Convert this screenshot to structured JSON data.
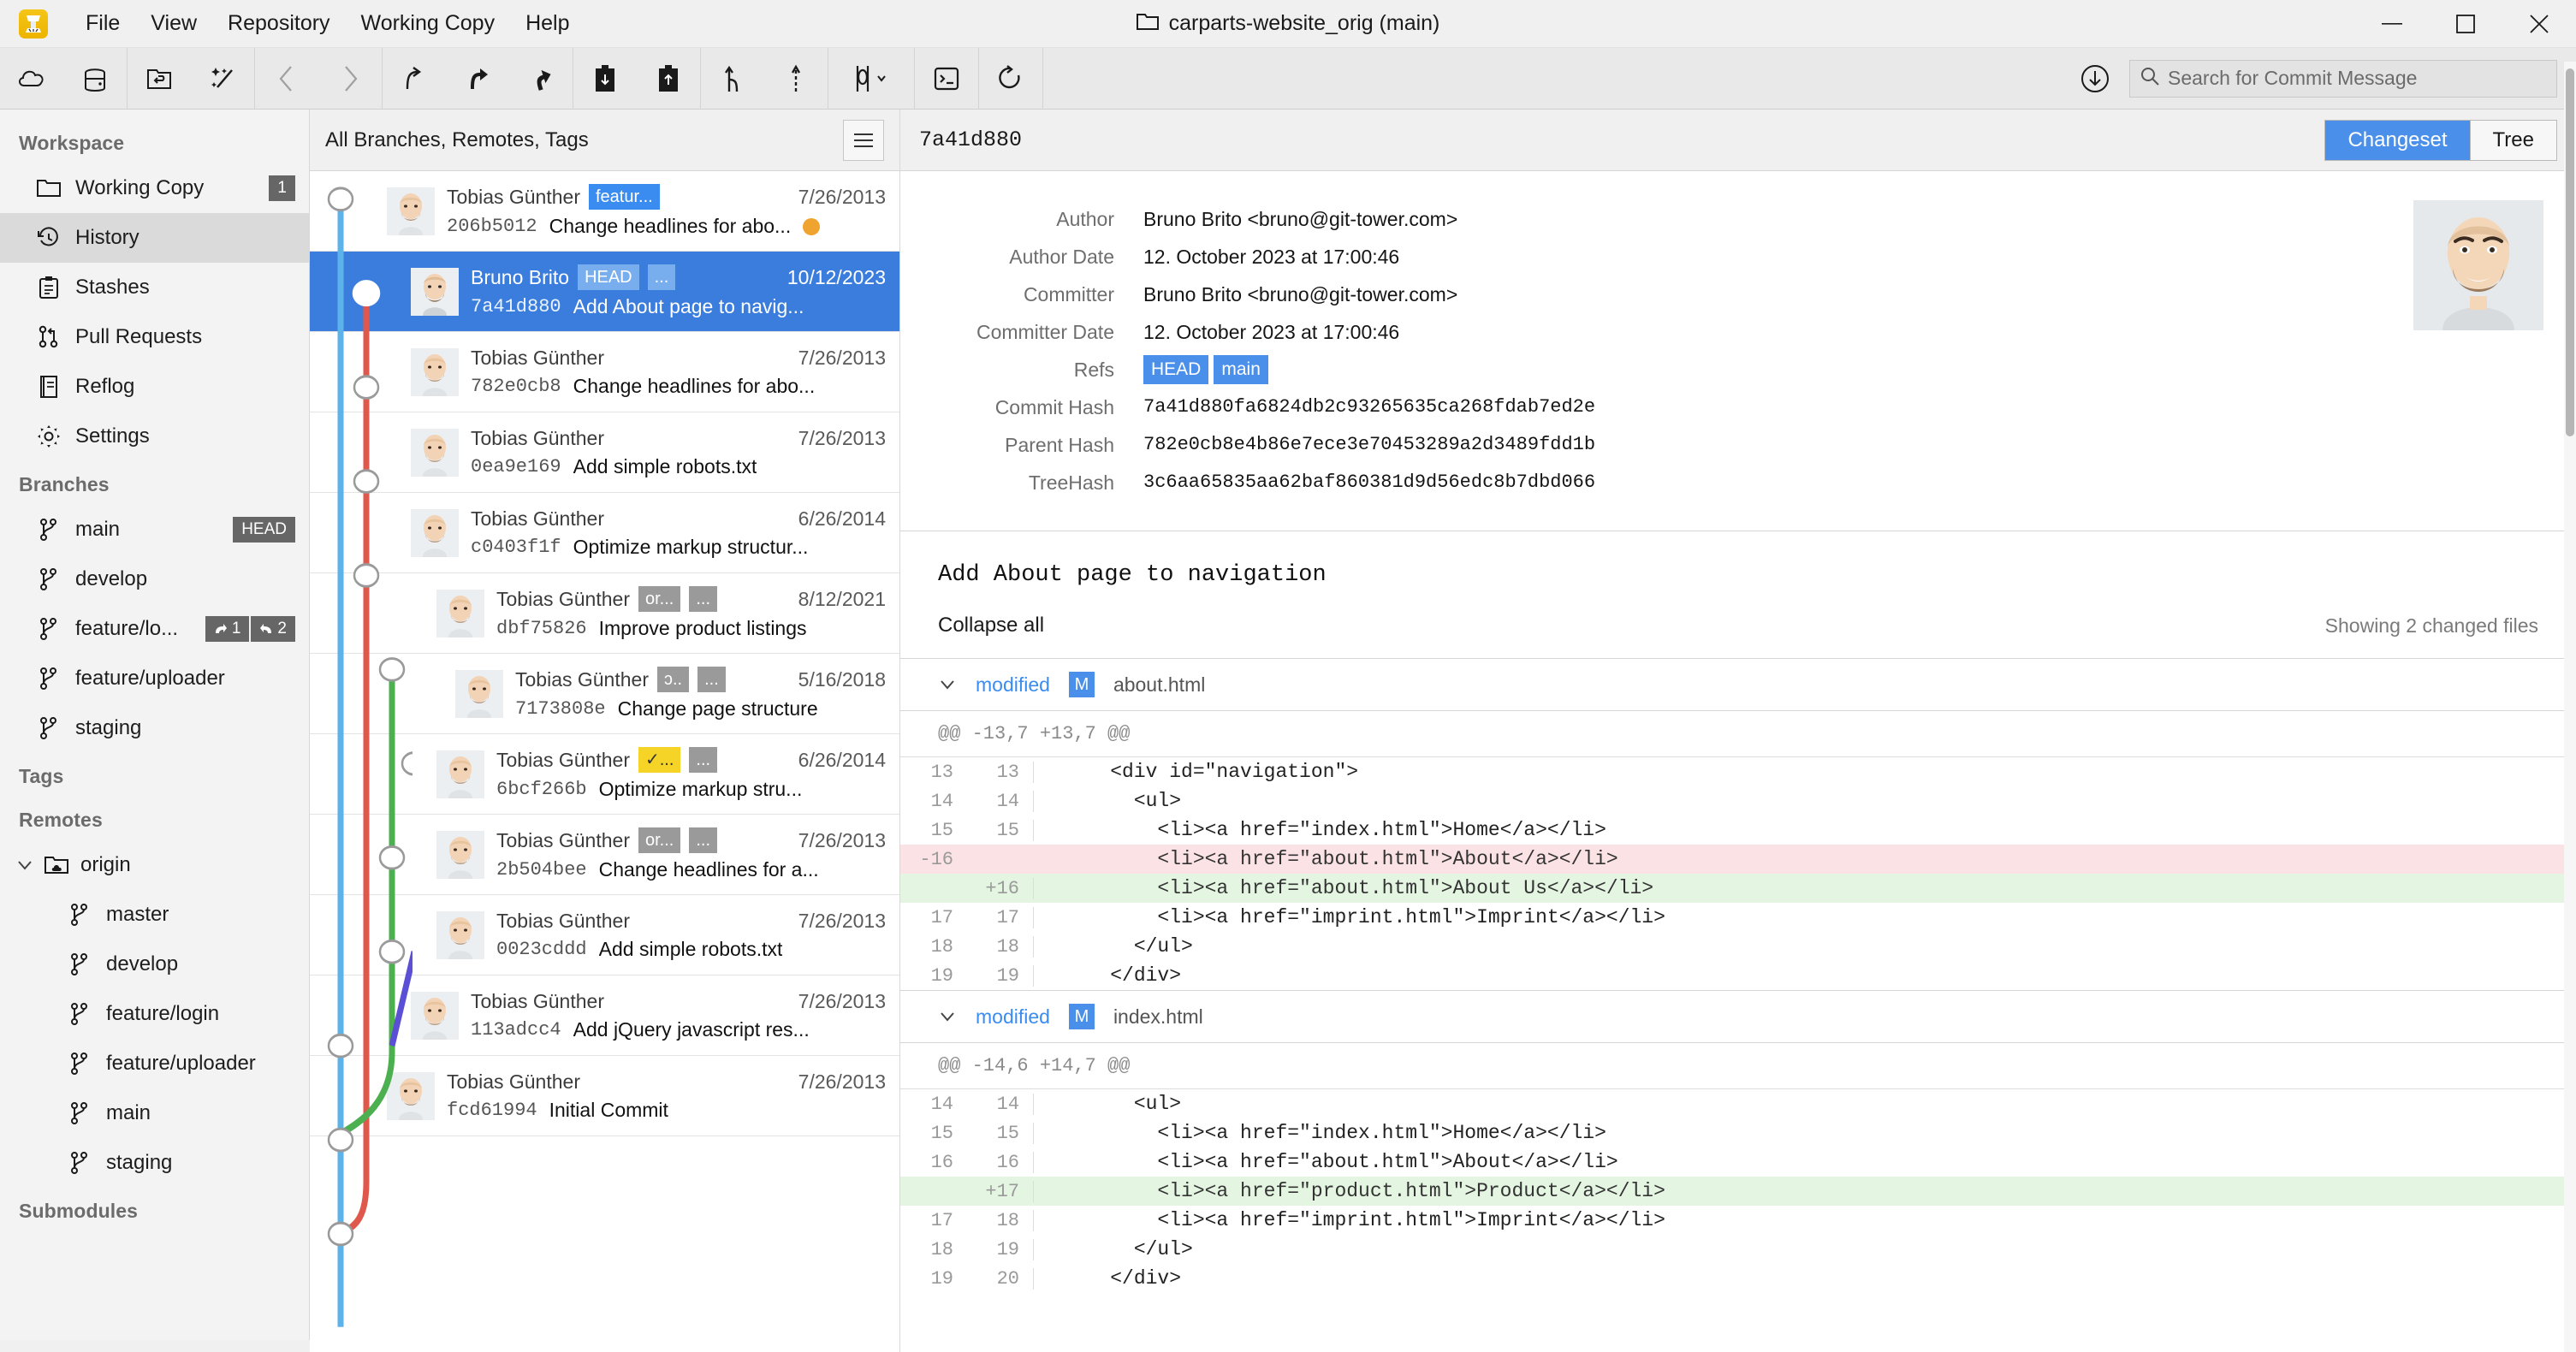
{
  "window": {
    "title": "carparts-website_orig (main)",
    "app_icon": "tower-app-icon",
    "controls": {
      "minimize": "minimize-icon",
      "maximize": "maximize-icon",
      "close": "close-icon"
    }
  },
  "menubar": {
    "items": [
      "File",
      "View",
      "Repository",
      "Working Copy",
      "Help"
    ]
  },
  "toolbar": {
    "groups": [
      {
        "buttons": [
          {
            "name": "clone-repository-button",
            "icon": "cloud-icon"
          },
          {
            "name": "open-repository-button",
            "icon": "drive-icon"
          }
        ]
      },
      {
        "buttons": [
          {
            "name": "discard-button",
            "icon": "folder-undo-icon"
          },
          {
            "name": "clean-button",
            "icon": "magic-wand-icon"
          }
        ]
      },
      {
        "buttons": [
          {
            "name": "back-button",
            "icon": "chevron-left-icon",
            "disabled": true
          },
          {
            "name": "forward-button",
            "icon": "chevron-right-icon",
            "disabled": true
          }
        ]
      },
      {
        "buttons": [
          {
            "name": "fetch-button",
            "icon": "fetch-arrow-icon"
          },
          {
            "name": "pull-button",
            "icon": "pull-arrow-icon"
          },
          {
            "name": "push-button",
            "icon": "push-arrow-icon"
          }
        ]
      },
      {
        "buttons": [
          {
            "name": "stash-button",
            "icon": "clipboard-down-icon"
          },
          {
            "name": "unstash-button",
            "icon": "clipboard-up-icon"
          }
        ]
      },
      {
        "buttons": [
          {
            "name": "branch-button",
            "icon": "branch-icon"
          },
          {
            "name": "tag-button",
            "icon": "tag-pin-icon"
          }
        ]
      },
      {
        "buttons": [
          {
            "name": "merge-button",
            "icon": "merge-dropdown-icon"
          }
        ]
      },
      {
        "buttons": [
          {
            "name": "terminal-button",
            "icon": "terminal-icon"
          }
        ]
      },
      {
        "buttons": [
          {
            "name": "refresh-button",
            "icon": "refresh-icon"
          }
        ]
      }
    ],
    "download_button": {
      "name": "download-button",
      "icon": "download-circle-icon"
    },
    "search": {
      "placeholder": "Search for Commit Message",
      "value": "",
      "icon": "search-icon"
    }
  },
  "sidebar": {
    "sections": [
      {
        "title": "Workspace",
        "items": [
          {
            "label": "Working Copy",
            "icon": "folder-icon",
            "badge": "1",
            "active": false
          },
          {
            "label": "History",
            "icon": "history-clock-icon",
            "badge": null,
            "active": true
          },
          {
            "label": "Stashes",
            "icon": "clipboard-icon",
            "badge": null,
            "active": false
          },
          {
            "label": "Pull Requests",
            "icon": "pull-request-icon",
            "badge": null,
            "active": false
          },
          {
            "label": "Reflog",
            "icon": "book-icon",
            "badge": null,
            "active": false
          },
          {
            "label": "Settings",
            "icon": "gear-icon",
            "badge": null,
            "active": false
          }
        ]
      },
      {
        "title": "Branches",
        "items": [
          {
            "label": "main",
            "icon": "branch-icon",
            "badge": "HEAD",
            "active": false
          },
          {
            "label": "develop",
            "icon": "branch-icon",
            "badge": null,
            "active": false
          },
          {
            "label": "feature/lo...",
            "icon": "branch-icon",
            "badge": null,
            "active": false,
            "ahead": "1",
            "behind": "2"
          },
          {
            "label": "feature/uploader",
            "icon": "branch-icon",
            "badge": null,
            "active": false
          },
          {
            "label": "staging",
            "icon": "branch-icon",
            "badge": null,
            "active": false
          }
        ]
      },
      {
        "title": "Tags",
        "items": []
      },
      {
        "title": "Remotes",
        "remote_name": "origin",
        "remote_icon": "remote-folder-icon",
        "chevron": "chevron-down-icon",
        "items": [
          {
            "label": "master",
            "icon": "branch-icon"
          },
          {
            "label": "develop",
            "icon": "branch-icon"
          },
          {
            "label": "feature/login",
            "icon": "branch-icon"
          },
          {
            "label": "feature/uploader",
            "icon": "branch-icon"
          },
          {
            "label": "main",
            "icon": "branch-icon"
          },
          {
            "label": "staging",
            "icon": "branch-icon"
          }
        ]
      },
      {
        "title": "Submodules",
        "items": []
      }
    ]
  },
  "commit_list": {
    "filter_label": "All Branches, Remotes, Tags",
    "menu_icon": "hamburger-icon",
    "rows": [
      {
        "author": "Tobias Günther",
        "hash": "206b5012",
        "message": "Change headlines for abo...",
        "date": "7/26/2013",
        "refs": [
          {
            "text": "featur...",
            "style": "blue"
          }
        ],
        "selected": false,
        "dot": true
      },
      {
        "author": "Bruno Brito",
        "hash": "7a41d880",
        "message": "Add About page to navig...",
        "date": "10/12/2023",
        "refs": [
          {
            "text": "HEAD",
            "style": "lightblue"
          },
          {
            "text": "...",
            "style": "lightblue"
          }
        ],
        "selected": true,
        "dot": false
      },
      {
        "author": "Tobias Günther",
        "hash": "782e0cb8",
        "message": "Change headlines for abo...",
        "date": "7/26/2013",
        "refs": [],
        "selected": false,
        "dot": false
      },
      {
        "author": "Tobias Günther",
        "hash": "0ea9e169",
        "message": "Add simple robots.txt",
        "date": "7/26/2013",
        "refs": [],
        "selected": false,
        "dot": false
      },
      {
        "author": "Tobias Günther",
        "hash": "c0403f1f",
        "message": "Optimize markup structur...",
        "date": "6/26/2014",
        "refs": [],
        "selected": false,
        "dot": false
      },
      {
        "author": "Tobias Günther",
        "hash": "dbf75826",
        "message": "Improve product listings",
        "date": "8/12/2021",
        "refs": [
          {
            "text": "or...",
            "style": "gray"
          },
          {
            "text": "...",
            "style": "gray"
          }
        ],
        "selected": false,
        "dot": false
      },
      {
        "author": "Tobias Günther",
        "hash": "7173808e",
        "message": "Change page structure",
        "date": "5/16/2018",
        "refs": [
          {
            "text": "ɔ..",
            "style": "gray"
          },
          {
            "text": "...",
            "style": "gray"
          }
        ],
        "selected": false,
        "dot": false
      },
      {
        "author": "Tobias Günther",
        "hash": "6bcf266b",
        "message": "Optimize markup stru...",
        "date": "6/26/2014",
        "refs": [
          {
            "text": "✓...",
            "style": "yellow"
          },
          {
            "text": "...",
            "style": "gray"
          }
        ],
        "selected": false,
        "dot": false
      },
      {
        "author": "Tobias Günther",
        "hash": "2b504bee",
        "message": "Change headlines for a...",
        "date": "7/26/2013",
        "refs": [
          {
            "text": "or...",
            "style": "gray"
          },
          {
            "text": "...",
            "style": "gray"
          }
        ],
        "selected": false,
        "dot": false
      },
      {
        "author": "Tobias Günther",
        "hash": "0023cddd",
        "message": "Add simple robots.txt",
        "date": "7/26/2013",
        "refs": [],
        "selected": false,
        "dot": false
      },
      {
        "author": "Tobias Günther",
        "hash": "113adcc4",
        "message": "Add jQuery javascript res...",
        "date": "7/26/2013",
        "refs": [],
        "selected": false,
        "dot": false
      },
      {
        "author": "Tobias Günther",
        "hash": "fcd61994",
        "message": "Initial Commit",
        "date": "7/26/2013",
        "refs": [],
        "selected": false,
        "dot": false
      }
    ]
  },
  "detail": {
    "header_hash": "7a41d880",
    "tabs": [
      {
        "label": "Changeset",
        "active": true
      },
      {
        "label": "Tree",
        "active": false
      }
    ],
    "meta": [
      {
        "key": "Author",
        "value": "Bruno Brito <bruno@git-tower.com>"
      },
      {
        "key": "Author Date",
        "value": "12. October 2023 at 17:00:46"
      },
      {
        "key": "Committer",
        "value": "Bruno Brito <bruno@git-tower.com>"
      },
      {
        "key": "Committer Date",
        "value": "12. October 2023 at 17:00:46"
      },
      {
        "key": "Refs",
        "value": ""
      },
      {
        "key": "Commit Hash",
        "value": "7a41d880fa6824db2c93265635ca268fdab7ed2e"
      },
      {
        "key": "Parent Hash",
        "value": "782e0cb8e4b86e7ece3e70453289a2d3489fdd1b"
      },
      {
        "key": "TreeHash",
        "value": "3c6aa65835aa62baf860381d9d56edc8b7dbd066"
      }
    ],
    "refs": [
      "HEAD",
      "main"
    ],
    "commit_message": "Add About page to navigation",
    "collapse_all": "Collapse all",
    "showing": "Showing 2 changed files",
    "files": [
      {
        "status": "modified",
        "status_letter": "M",
        "name": "about.html",
        "chevron": "chevron-down-icon",
        "hunk": "@@ -13,7 +13,7 @@",
        "lines": [
          {
            "old": "13",
            "new": "13",
            "type": "ctx",
            "code": "    <div id=\"navigation\">"
          },
          {
            "old": "14",
            "new": "14",
            "type": "ctx",
            "code": "      <ul>"
          },
          {
            "old": "15",
            "new": "15",
            "type": "ctx",
            "code": "        <li><a href=\"index.html\">Home</a></li>"
          },
          {
            "old": "-16",
            "new": "",
            "type": "del",
            "code": "        <li><a href=\"about.html\">About</a></li>"
          },
          {
            "old": "",
            "new": "+16",
            "type": "add",
            "code": "        <li><a href=\"about.html\">About Us</a></li>"
          },
          {
            "old": "17",
            "new": "17",
            "type": "ctx",
            "code": "        <li><a href=\"imprint.html\">Imprint</a></li>"
          },
          {
            "old": "18",
            "new": "18",
            "type": "ctx",
            "code": "      </ul>"
          },
          {
            "old": "19",
            "new": "19",
            "type": "ctx",
            "code": "    </div>"
          }
        ]
      },
      {
        "status": "modified",
        "status_letter": "M",
        "name": "index.html",
        "chevron": "chevron-down-icon",
        "hunk": "@@ -14,6 +14,7 @@",
        "lines": [
          {
            "old": "14",
            "new": "14",
            "type": "ctx",
            "code": "      <ul>"
          },
          {
            "old": "15",
            "new": "15",
            "type": "ctx",
            "code": "        <li><a href=\"index.html\">Home</a></li>"
          },
          {
            "old": "16",
            "new": "16",
            "type": "ctx",
            "code": "        <li><a href=\"about.html\">About</a></li>"
          },
          {
            "old": "",
            "new": "+17",
            "type": "add",
            "code": "        <li><a href=\"product.html\">Product</a></li>"
          },
          {
            "old": "17",
            "new": "18",
            "type": "ctx",
            "code": "        <li><a href=\"imprint.html\">Imprint</a></li>"
          },
          {
            "old": "18",
            "new": "19",
            "type": "ctx",
            "code": "      </ul>"
          },
          {
            "old": "19",
            "new": "20",
            "type": "ctx",
            "code": "    </div>"
          }
        ]
      }
    ]
  },
  "colors": {
    "accent_blue": "#3b7ddd",
    "tab_blue": "#4a90ea",
    "graph_blue": "#5bb3ea",
    "graph_red": "#e0574c",
    "graph_green": "#4caf50",
    "graph_purple": "#5b4fd6",
    "add_green": "#e4f6e2",
    "del_red": "#fbe2e4",
    "badge_gray": "#666666"
  }
}
